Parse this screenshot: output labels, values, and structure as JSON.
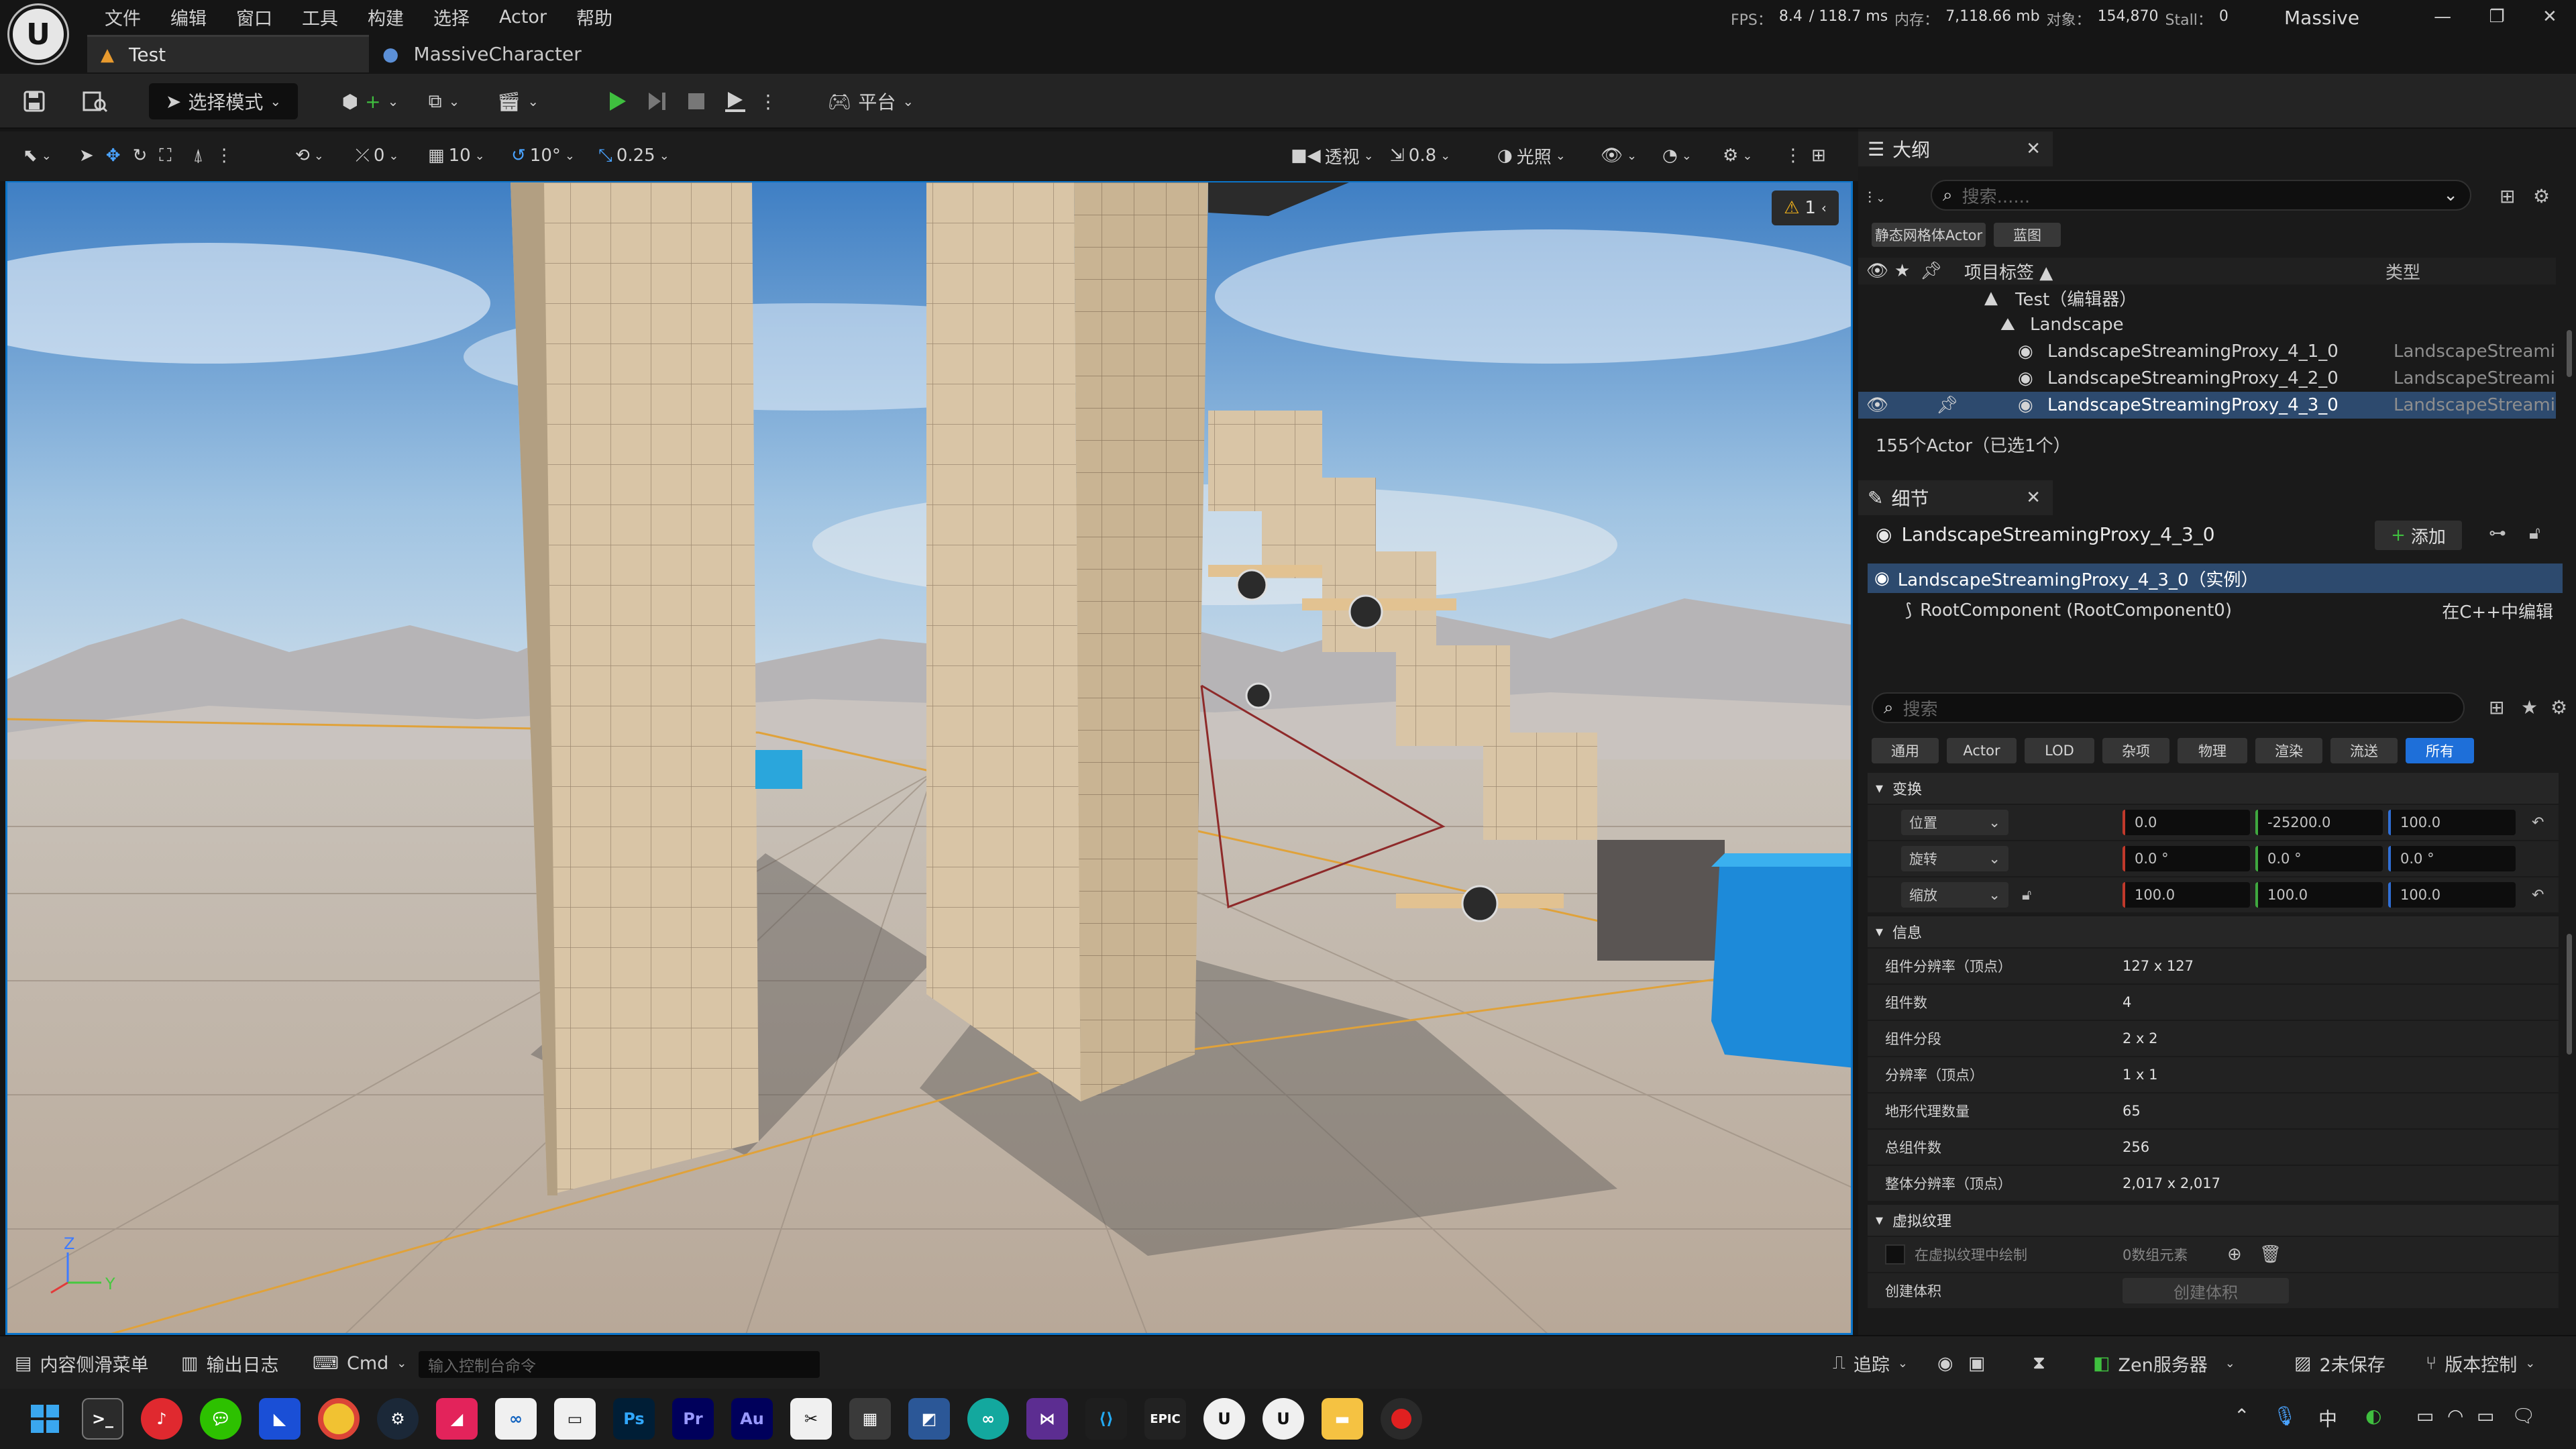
{
  "menu": [
    "文件",
    "编辑",
    "窗口",
    "工具",
    "构建",
    "选择",
    "Actor",
    "帮助"
  ],
  "tabs": {
    "level": "Test",
    "character": "MassiveCharacter"
  },
  "stats": {
    "fps_label": "FPS：",
    "fps": "8.4",
    "ms": "/ 118.7 ms",
    "mem_label": "内存：",
    "mem": "7,118.66 mb",
    "obj_label": "对象：",
    "obj": "154,870",
    "stall_label": "Stall：",
    "stall": "0"
  },
  "project": "Massive",
  "toolbar": {
    "mode": "选择模式",
    "platform": "平台"
  },
  "vp_toolbar": {
    "rot_snap": "0",
    "grid_snap": "10",
    "angle_snap": "10°",
    "scale_snap": "0.25",
    "perspective": "透视",
    "cam_speed": "0.8",
    "lighting": "光照"
  },
  "viewport": {
    "warnings": "1"
  },
  "outliner": {
    "title": "大纲",
    "search_placeholder": "搜索......",
    "chips": [
      "静态网格体Actor",
      "蓝图"
    ],
    "col_label": "项目标签 ▲",
    "col_type": "类型",
    "rows": [
      {
        "label": "Test（编辑器）",
        "type": ""
      },
      {
        "label": "Landscape",
        "type": ""
      },
      {
        "label": "LandscapeStreamingProxy_4_1_0",
        "type": "LandscapeStreamingProxy"
      },
      {
        "label": "LandscapeStreamingProxy_4_2_0",
        "type": "LandscapeStreamingProxy"
      },
      {
        "label": "LandscapeStreamingProxy_4_3_0",
        "type": "LandscapeStreamingProxy"
      }
    ],
    "count": "155个Actor（已选1个）"
  },
  "details": {
    "title": "细节",
    "actor_name": "LandscapeStreamingProxy_4_3_0",
    "add": "添加",
    "instance": "LandscapeStreamingProxy_4_3_0（实例）",
    "root": "RootComponent (RootComponent0)",
    "edit_cpp": "在C++中编辑",
    "search_placeholder": "搜索",
    "filters": [
      "通用",
      "Actor",
      "LOD",
      "杂项",
      "物理",
      "渲染",
      "流送",
      "所有"
    ],
    "transform_section": "变换",
    "transform": [
      {
        "label": "位置",
        "x": "0.0",
        "y": "-25200.0",
        "z": "100.0"
      },
      {
        "label": "旋转",
        "x": "0.0 °",
        "y": "0.0 °",
        "z": "0.0 °"
      },
      {
        "label": "缩放",
        "x": "100.0",
        "y": "100.0",
        "z": "100.0"
      }
    ],
    "info_section": "信息",
    "info": [
      {
        "label": "组件分辨率（顶点）",
        "value": "127 x 127"
      },
      {
        "label": "组件数",
        "value": "4"
      },
      {
        "label": "组件分段",
        "value": "2 x 2"
      },
      {
        "label": "分辨率（顶点）",
        "value": "1 x 1"
      },
      {
        "label": "地形代理数量",
        "value": "65"
      },
      {
        "label": "总组件数",
        "value": "256"
      },
      {
        "label": "整体分辨率（顶点）",
        "value": "2,017 x 2,017"
      }
    ],
    "vt_section": "虚拟纹理",
    "vt_draw": "在虚拟纹理中绘制",
    "vt_elements": "0数组元素",
    "create_volume_label": "创建体积",
    "create_volume_btn": "创建体积"
  },
  "bottom": {
    "content_drawer": "内容侧滑菜单",
    "output_log": "输出日志",
    "cmd": "Cmd",
    "cmd_placeholder": "输入控制台命令",
    "trace": "追踪",
    "zen": "Zen服务器",
    "unsaved": "2未保存",
    "source_control": "版本控制"
  },
  "taskbar": {
    "ime": "中",
    "apps": [
      "Ps",
      "Pr",
      "Au"
    ]
  },
  "colors": {
    "accent": "#0b74c9",
    "play": "#3fbf3f",
    "selection": "#2d4a6e"
  }
}
